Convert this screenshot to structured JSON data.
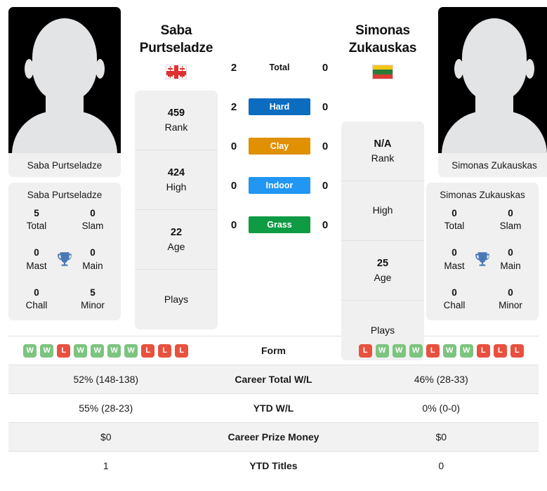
{
  "players": {
    "left": {
      "name": "Saba Purtseladze",
      "name_line1": "Saba",
      "name_line2": "Purtseladze",
      "photo_caption": "Saba Purtseladze",
      "flag": "georgia-flag",
      "ranks": [
        {
          "value": "459",
          "label": "Rank"
        },
        {
          "value": "424",
          "label": "High"
        },
        {
          "value": "22",
          "label": "Age"
        },
        {
          "value": "",
          "label": "Plays"
        }
      ],
      "titles": [
        {
          "value": "5",
          "label": "Total"
        },
        {
          "value": "0",
          "label": "Slam"
        },
        {
          "value": "0",
          "label": "Mast"
        },
        {
          "value": "0",
          "label": "Main"
        },
        {
          "value": "0",
          "label": "Chall"
        },
        {
          "value": "5",
          "label": "Minor"
        }
      ],
      "form": [
        "W",
        "W",
        "L",
        "W",
        "W",
        "W",
        "W",
        "L",
        "L",
        "L"
      ],
      "surface_wins": [
        "2",
        "2",
        "0",
        "0",
        "0"
      ],
      "career_total_wl": "52% (148-138)",
      "ytd_wl": "55% (28-23)",
      "career_prize_money": "$0",
      "ytd_titles": "1"
    },
    "right": {
      "name": "Simonas Zukauskas",
      "name_line1": "Simonas",
      "name_line2": "Zukauskas",
      "photo_caption": "Simonas Zukauskas",
      "flag": "lithuania-flag",
      "ranks": [
        {
          "value": "N/A",
          "label": "Rank"
        },
        {
          "value": "",
          "label": "High"
        },
        {
          "value": "25",
          "label": "Age"
        },
        {
          "value": "",
          "label": "Plays"
        }
      ],
      "titles": [
        {
          "value": "0",
          "label": "Total"
        },
        {
          "value": "0",
          "label": "Slam"
        },
        {
          "value": "0",
          "label": "Mast"
        },
        {
          "value": "0",
          "label": "Main"
        },
        {
          "value": "0",
          "label": "Chall"
        },
        {
          "value": "0",
          "label": "Minor"
        }
      ],
      "form": [
        "L",
        "W",
        "W",
        "W",
        "L",
        "W",
        "W",
        "L",
        "L",
        "L"
      ],
      "surface_wins": [
        "0",
        "0",
        "0",
        "0",
        "0"
      ],
      "career_total_wl": "46% (28-33)",
      "ytd_wl": "0% (0-0)",
      "career_prize_money": "$0",
      "ytd_titles": "0"
    }
  },
  "surfaces": [
    {
      "label": "Total",
      "style": "plain",
      "color": ""
    },
    {
      "label": "Hard",
      "style": "chip",
      "color": "#0c6cc0"
    },
    {
      "label": "Clay",
      "style": "chip",
      "color": "#e09000"
    },
    {
      "label": "Indoor",
      "style": "chip",
      "color": "#2196f3"
    },
    {
      "label": "Grass",
      "style": "chip",
      "color": "#0e9b43"
    }
  ],
  "table_labels": {
    "form": "Form",
    "career_total_wl": "Career Total W/L",
    "ytd_wl": "YTD W/L",
    "career_prize_money": "Career Prize Money",
    "ytd_titles": "YTD Titles"
  },
  "colors": {
    "win_badge": "#7cc47f",
    "loss_badge": "#e8513f",
    "trophy": "#4a7ab5",
    "card_bg": "#f0f0f0",
    "row_shaded": "#f2f2f2"
  }
}
